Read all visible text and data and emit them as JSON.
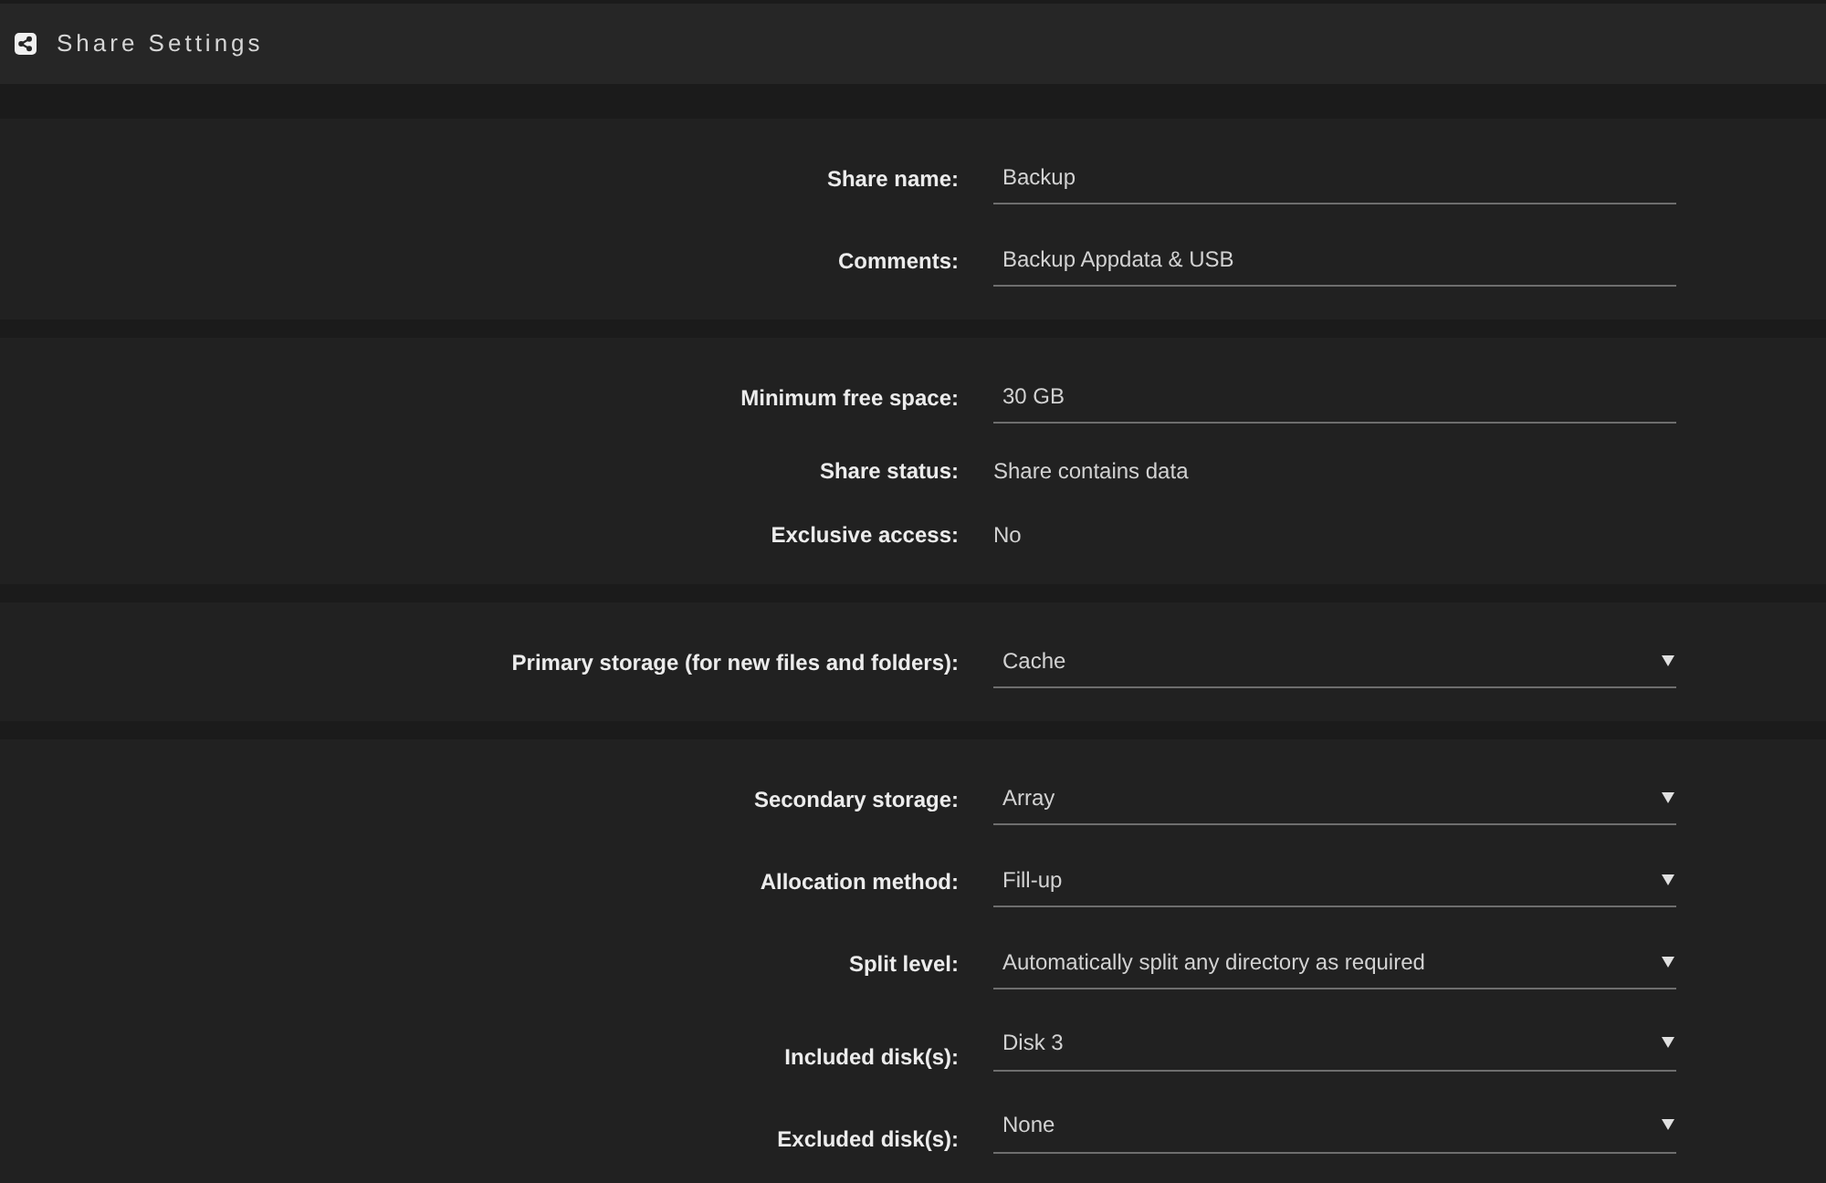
{
  "header": {
    "title": "Share Settings"
  },
  "sections": [
    {
      "rows": [
        {
          "kind": "input",
          "label": "Share name:",
          "value": "Backup"
        },
        {
          "kind": "input",
          "label": "Comments:",
          "value": "Backup Appdata & USB"
        }
      ]
    },
    {
      "rows": [
        {
          "kind": "input",
          "label": "Minimum free space:",
          "value": "30 GB"
        },
        {
          "kind": "text",
          "label": "Share status:",
          "value": "Share contains data"
        },
        {
          "kind": "text",
          "label": "Exclusive access:",
          "value": "No"
        }
      ]
    },
    {
      "rows": [
        {
          "kind": "select",
          "label": "Primary storage (for new files and folders):",
          "value": "Cache"
        }
      ]
    },
    {
      "rows": [
        {
          "kind": "select",
          "label": "Secondary storage:",
          "value": "Array"
        },
        {
          "kind": "select",
          "label": "Allocation method:",
          "value": "Fill-up"
        },
        {
          "kind": "select",
          "label": "Split level:",
          "value": "Automatically split any directory as required"
        },
        {
          "kind": "multiselect",
          "label": "Included disk(s):",
          "value": "Disk 3"
        },
        {
          "kind": "multiselect",
          "label": "Excluded disk(s):",
          "value": "None"
        }
      ]
    }
  ]
}
